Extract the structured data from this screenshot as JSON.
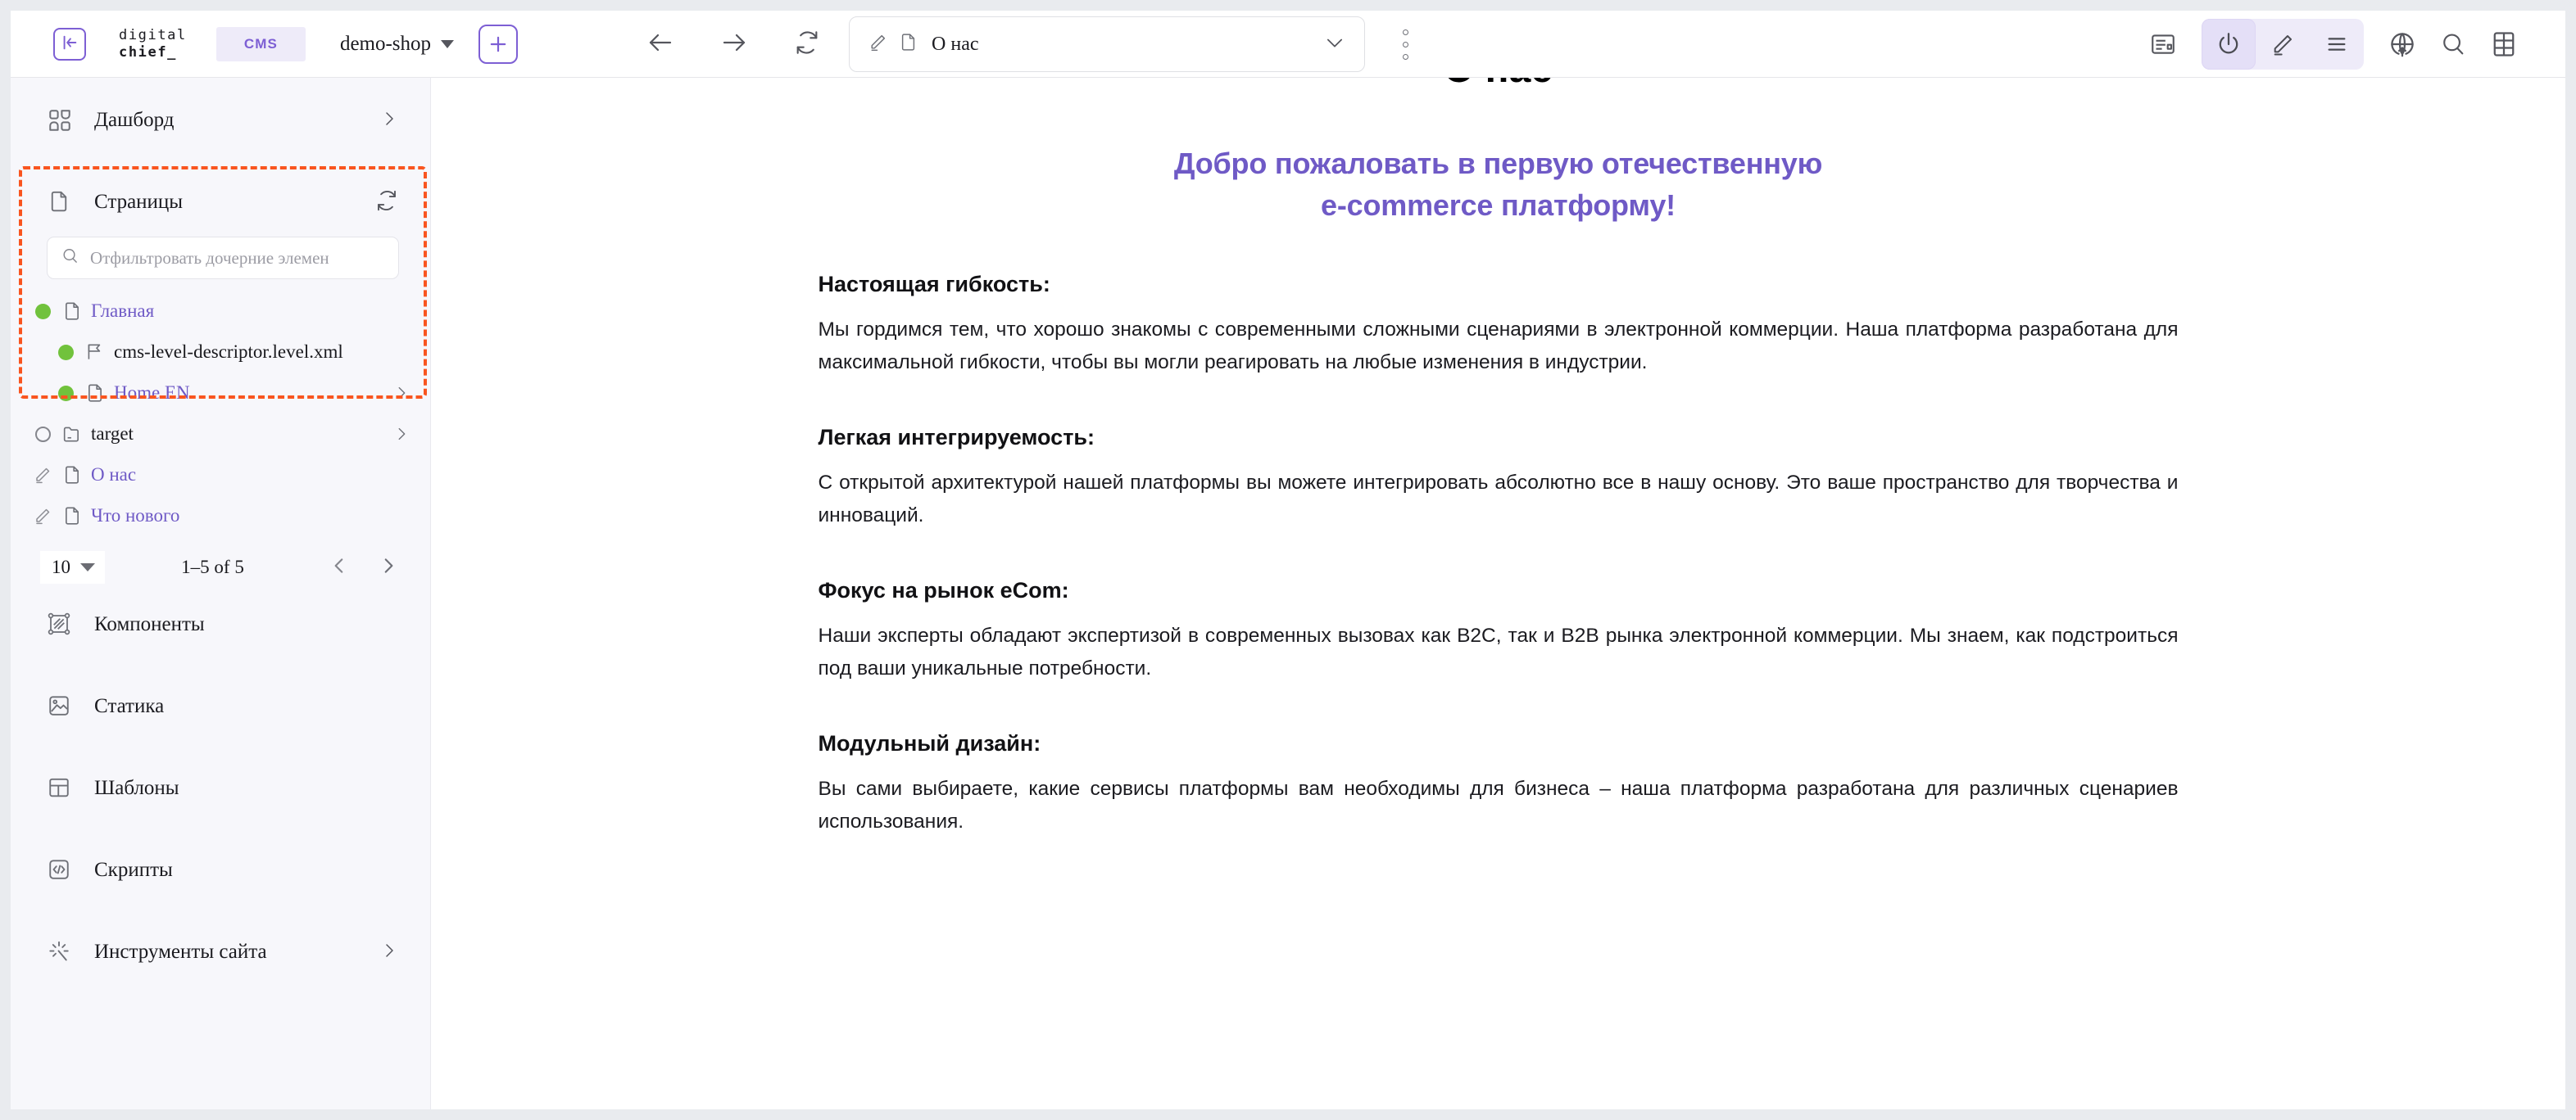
{
  "topbar": {
    "collapse_icon": "panel-collapse-left-icon",
    "brand_line1": "digital",
    "brand_line2": "chief_",
    "cms_badge": "CMS",
    "site_name": "demo-shop",
    "add_label": "+",
    "nav": {
      "back": "arrow-left-icon",
      "forward": "arrow-right-icon",
      "reload": "refresh-icon"
    },
    "address": {
      "edit_icon": "pencil-icon",
      "page_icon": "file-icon",
      "title": "О нас",
      "expand_icon": "chevron-down-icon"
    },
    "kebab": "more-vertical-icon",
    "tools": [
      {
        "name": "layout-preview-icon",
        "active": false
      },
      {
        "name": "power-icon",
        "active": true
      },
      {
        "name": "pencil-edit-icon",
        "active": false
      },
      {
        "name": "list-menu-icon",
        "active": false
      },
      {
        "name": "publish-globe-icon",
        "active": false
      },
      {
        "name": "search-icon",
        "active": false
      },
      {
        "name": "grid-icon",
        "active": false
      }
    ]
  },
  "sidebar": {
    "dashboard": {
      "label": "Дашборд",
      "icon": "dashboard-icon",
      "chevron": "chevron-right-icon"
    },
    "pages": {
      "label": "Страницы",
      "icon": "file-icon",
      "refresh_icon": "refresh-icon",
      "filter_placeholder": "Отфильтровать дочерние элемен",
      "filter_value": "",
      "search_icon": "search-icon",
      "tree": [
        {
          "label": "Главная",
          "status": "green",
          "type": "file",
          "indent": 1,
          "chevron": false,
          "link": true
        },
        {
          "label": "cms-level-descriptor.level.xml",
          "status": "green",
          "type": "flag",
          "indent": 2,
          "chevron": false,
          "link": false
        },
        {
          "label": "Home EN",
          "status": "green",
          "type": "file",
          "indent": 2,
          "chevron": true,
          "link": true
        },
        {
          "label": "target",
          "status": "empty",
          "type": "folder",
          "indent": 1,
          "chevron": true,
          "link": false
        },
        {
          "label": "О нас",
          "status": "edit",
          "type": "file",
          "indent": 1,
          "chevron": false,
          "link": true
        },
        {
          "label": "Что нового",
          "status": "edit",
          "type": "file",
          "indent": 1,
          "chevron": false,
          "link": true
        }
      ],
      "paging": {
        "page_size": "10",
        "range": "1–5 of 5",
        "prev_icon": "chevron-left-icon",
        "next_icon": "chevron-right-icon"
      }
    },
    "items": [
      {
        "label": "Компоненты",
        "icon": "components-icon",
        "chevron": false
      },
      {
        "label": "Статика",
        "icon": "image-icon",
        "chevron": false
      },
      {
        "label": "Шаблоны",
        "icon": "template-icon",
        "chevron": false
      },
      {
        "label": "Скрипты",
        "icon": "code-icon",
        "chevron": false
      },
      {
        "label": "Инструменты сайта",
        "icon": "tools-icon",
        "chevron": true
      }
    ]
  },
  "content": {
    "title": "О нас",
    "subtitle_line1": "Добро пожаловать в первую отечественную",
    "subtitle_line2": "e-commerce платформу!",
    "sections": [
      {
        "heading": "Настоящая гибкость:",
        "body": "Мы гордимся тем, что хорошо знакомы с современными сложными сценариями в электронной коммерции. Наша платформа разработана для максимальной гибкости, чтобы вы могли реагировать на любые изменения в индустрии."
      },
      {
        "heading": "Легкая интегрируемость:",
        "body": "С открытой архитектурой нашей платформы вы можете интегрировать абсолютно все в нашу основу. Это ваше пространство для творчества и инноваций."
      },
      {
        "heading": "Фокус на рынок eCom:",
        "body": "Наши эксперты обладают экспертизой в современных вызовах как B2C, так и B2B рынка электронной коммерции. Мы знаем, как подстроиться под ваши уникальные потребности."
      },
      {
        "heading": "Модульный дизайн:",
        "body": "Вы сами выбираете, какие сервисы платформы вам необходимы для бизнеса – наша платформа разработана для различных сценариев использования."
      }
    ]
  },
  "colors": {
    "accent": "#7d5fd4",
    "link": "#6f5ac6",
    "highlight": "#f9551f",
    "status_green": "#71c23c",
    "sidebar_bg": "#f7f7fb"
  }
}
